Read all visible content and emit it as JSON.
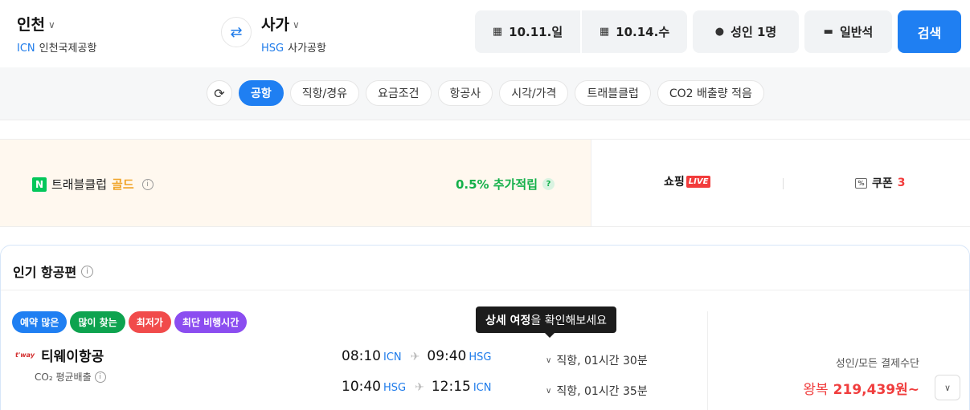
{
  "header": {
    "from": {
      "city": "인천",
      "code": "ICN",
      "airport": "인천국제공항"
    },
    "to": {
      "city": "사가",
      "code": "HSG",
      "airport": "사가공항"
    },
    "depart_date": "10.11.일",
    "return_date": "10.14.수",
    "passengers": "성인 1명",
    "seat_class": "일반석",
    "search_label": "검색"
  },
  "filters": {
    "chips": [
      "공항",
      "직항/경유",
      "요금조건",
      "항공사",
      "시각/가격",
      "트래블클럽",
      "CO2 배출량 적음"
    ],
    "active": "공항"
  },
  "promo": {
    "club_prefix": "트래블클럽",
    "club_tier": "골드",
    "accrue_text": "0.5% 추가적립",
    "shopping_label": "쇼핑",
    "live_badge": "LIVE",
    "coupon_label": "쿠폰",
    "coupon_count": "3"
  },
  "popular": {
    "title": "인기 항공편",
    "tooltip_bold": "상세 여정",
    "tooltip_rest": "을 확인해보세요",
    "flight": {
      "tags": [
        {
          "label": "예약 많은",
          "color": "#1f7ff2"
        },
        {
          "label": "많이 찾는",
          "color": "#0ea34f"
        },
        {
          "label": "최저가",
          "color": "#f14b4b"
        },
        {
          "label": "최단 비행시간",
          "color": "#8b4df0"
        }
      ],
      "airline_logo": "t'way",
      "airline": "티웨이항공",
      "co2_label": "CO₂ 평균배출",
      "legs": [
        {
          "dep_time": "08:10",
          "dep_code": "ICN",
          "arr_time": "09:40",
          "arr_code": "HSG",
          "duration": "직항, 01시간 30분"
        },
        {
          "dep_time": "10:40",
          "dep_code": "HSG",
          "arr_time": "12:15",
          "arr_code": "ICN",
          "duration": "직항, 01시간 35분"
        }
      ],
      "price_label": "성인/모든 결제수단",
      "trip_type": "왕복",
      "price": "219,439원~"
    }
  }
}
